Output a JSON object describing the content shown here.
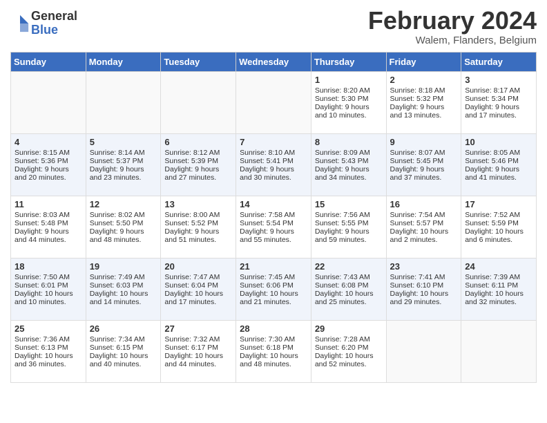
{
  "logo": {
    "general": "General",
    "blue": "Blue"
  },
  "title": "February 2024",
  "location": "Walem, Flanders, Belgium",
  "days_of_week": [
    "Sunday",
    "Monday",
    "Tuesday",
    "Wednesday",
    "Thursday",
    "Friday",
    "Saturday"
  ],
  "weeks": [
    [
      {
        "day": "",
        "sunrise": "",
        "sunset": "",
        "daylight": ""
      },
      {
        "day": "",
        "sunrise": "",
        "sunset": "",
        "daylight": ""
      },
      {
        "day": "",
        "sunrise": "",
        "sunset": "",
        "daylight": ""
      },
      {
        "day": "",
        "sunrise": "",
        "sunset": "",
        "daylight": ""
      },
      {
        "day": "1",
        "sunrise": "Sunrise: 8:20 AM",
        "sunset": "Sunset: 5:30 PM",
        "daylight": "Daylight: 9 hours and 10 minutes."
      },
      {
        "day": "2",
        "sunrise": "Sunrise: 8:18 AM",
        "sunset": "Sunset: 5:32 PM",
        "daylight": "Daylight: 9 hours and 13 minutes."
      },
      {
        "day": "3",
        "sunrise": "Sunrise: 8:17 AM",
        "sunset": "Sunset: 5:34 PM",
        "daylight": "Daylight: 9 hours and 17 minutes."
      }
    ],
    [
      {
        "day": "4",
        "sunrise": "Sunrise: 8:15 AM",
        "sunset": "Sunset: 5:36 PM",
        "daylight": "Daylight: 9 hours and 20 minutes."
      },
      {
        "day": "5",
        "sunrise": "Sunrise: 8:14 AM",
        "sunset": "Sunset: 5:37 PM",
        "daylight": "Daylight: 9 hours and 23 minutes."
      },
      {
        "day": "6",
        "sunrise": "Sunrise: 8:12 AM",
        "sunset": "Sunset: 5:39 PM",
        "daylight": "Daylight: 9 hours and 27 minutes."
      },
      {
        "day": "7",
        "sunrise": "Sunrise: 8:10 AM",
        "sunset": "Sunset: 5:41 PM",
        "daylight": "Daylight: 9 hours and 30 minutes."
      },
      {
        "day": "8",
        "sunrise": "Sunrise: 8:09 AM",
        "sunset": "Sunset: 5:43 PM",
        "daylight": "Daylight: 9 hours and 34 minutes."
      },
      {
        "day": "9",
        "sunrise": "Sunrise: 8:07 AM",
        "sunset": "Sunset: 5:45 PM",
        "daylight": "Daylight: 9 hours and 37 minutes."
      },
      {
        "day": "10",
        "sunrise": "Sunrise: 8:05 AM",
        "sunset": "Sunset: 5:46 PM",
        "daylight": "Daylight: 9 hours and 41 minutes."
      }
    ],
    [
      {
        "day": "11",
        "sunrise": "Sunrise: 8:03 AM",
        "sunset": "Sunset: 5:48 PM",
        "daylight": "Daylight: 9 hours and 44 minutes."
      },
      {
        "day": "12",
        "sunrise": "Sunrise: 8:02 AM",
        "sunset": "Sunset: 5:50 PM",
        "daylight": "Daylight: 9 hours and 48 minutes."
      },
      {
        "day": "13",
        "sunrise": "Sunrise: 8:00 AM",
        "sunset": "Sunset: 5:52 PM",
        "daylight": "Daylight: 9 hours and 51 minutes."
      },
      {
        "day": "14",
        "sunrise": "Sunrise: 7:58 AM",
        "sunset": "Sunset: 5:54 PM",
        "daylight": "Daylight: 9 hours and 55 minutes."
      },
      {
        "day": "15",
        "sunrise": "Sunrise: 7:56 AM",
        "sunset": "Sunset: 5:55 PM",
        "daylight": "Daylight: 9 hours and 59 minutes."
      },
      {
        "day": "16",
        "sunrise": "Sunrise: 7:54 AM",
        "sunset": "Sunset: 5:57 PM",
        "daylight": "Daylight: 10 hours and 2 minutes."
      },
      {
        "day": "17",
        "sunrise": "Sunrise: 7:52 AM",
        "sunset": "Sunset: 5:59 PM",
        "daylight": "Daylight: 10 hours and 6 minutes."
      }
    ],
    [
      {
        "day": "18",
        "sunrise": "Sunrise: 7:50 AM",
        "sunset": "Sunset: 6:01 PM",
        "daylight": "Daylight: 10 hours and 10 minutes."
      },
      {
        "day": "19",
        "sunrise": "Sunrise: 7:49 AM",
        "sunset": "Sunset: 6:03 PM",
        "daylight": "Daylight: 10 hours and 14 minutes."
      },
      {
        "day": "20",
        "sunrise": "Sunrise: 7:47 AM",
        "sunset": "Sunset: 6:04 PM",
        "daylight": "Daylight: 10 hours and 17 minutes."
      },
      {
        "day": "21",
        "sunrise": "Sunrise: 7:45 AM",
        "sunset": "Sunset: 6:06 PM",
        "daylight": "Daylight: 10 hours and 21 minutes."
      },
      {
        "day": "22",
        "sunrise": "Sunrise: 7:43 AM",
        "sunset": "Sunset: 6:08 PM",
        "daylight": "Daylight: 10 hours and 25 minutes."
      },
      {
        "day": "23",
        "sunrise": "Sunrise: 7:41 AM",
        "sunset": "Sunset: 6:10 PM",
        "daylight": "Daylight: 10 hours and 29 minutes."
      },
      {
        "day": "24",
        "sunrise": "Sunrise: 7:39 AM",
        "sunset": "Sunset: 6:11 PM",
        "daylight": "Daylight: 10 hours and 32 minutes."
      }
    ],
    [
      {
        "day": "25",
        "sunrise": "Sunrise: 7:36 AM",
        "sunset": "Sunset: 6:13 PM",
        "daylight": "Daylight: 10 hours and 36 minutes."
      },
      {
        "day": "26",
        "sunrise": "Sunrise: 7:34 AM",
        "sunset": "Sunset: 6:15 PM",
        "daylight": "Daylight: 10 hours and 40 minutes."
      },
      {
        "day": "27",
        "sunrise": "Sunrise: 7:32 AM",
        "sunset": "Sunset: 6:17 PM",
        "daylight": "Daylight: 10 hours and 44 minutes."
      },
      {
        "day": "28",
        "sunrise": "Sunrise: 7:30 AM",
        "sunset": "Sunset: 6:18 PM",
        "daylight": "Daylight: 10 hours and 48 minutes."
      },
      {
        "day": "29",
        "sunrise": "Sunrise: 7:28 AM",
        "sunset": "Sunset: 6:20 PM",
        "daylight": "Daylight: 10 hours and 52 minutes."
      },
      {
        "day": "",
        "sunrise": "",
        "sunset": "",
        "daylight": ""
      },
      {
        "day": "",
        "sunrise": "",
        "sunset": "",
        "daylight": ""
      }
    ]
  ]
}
